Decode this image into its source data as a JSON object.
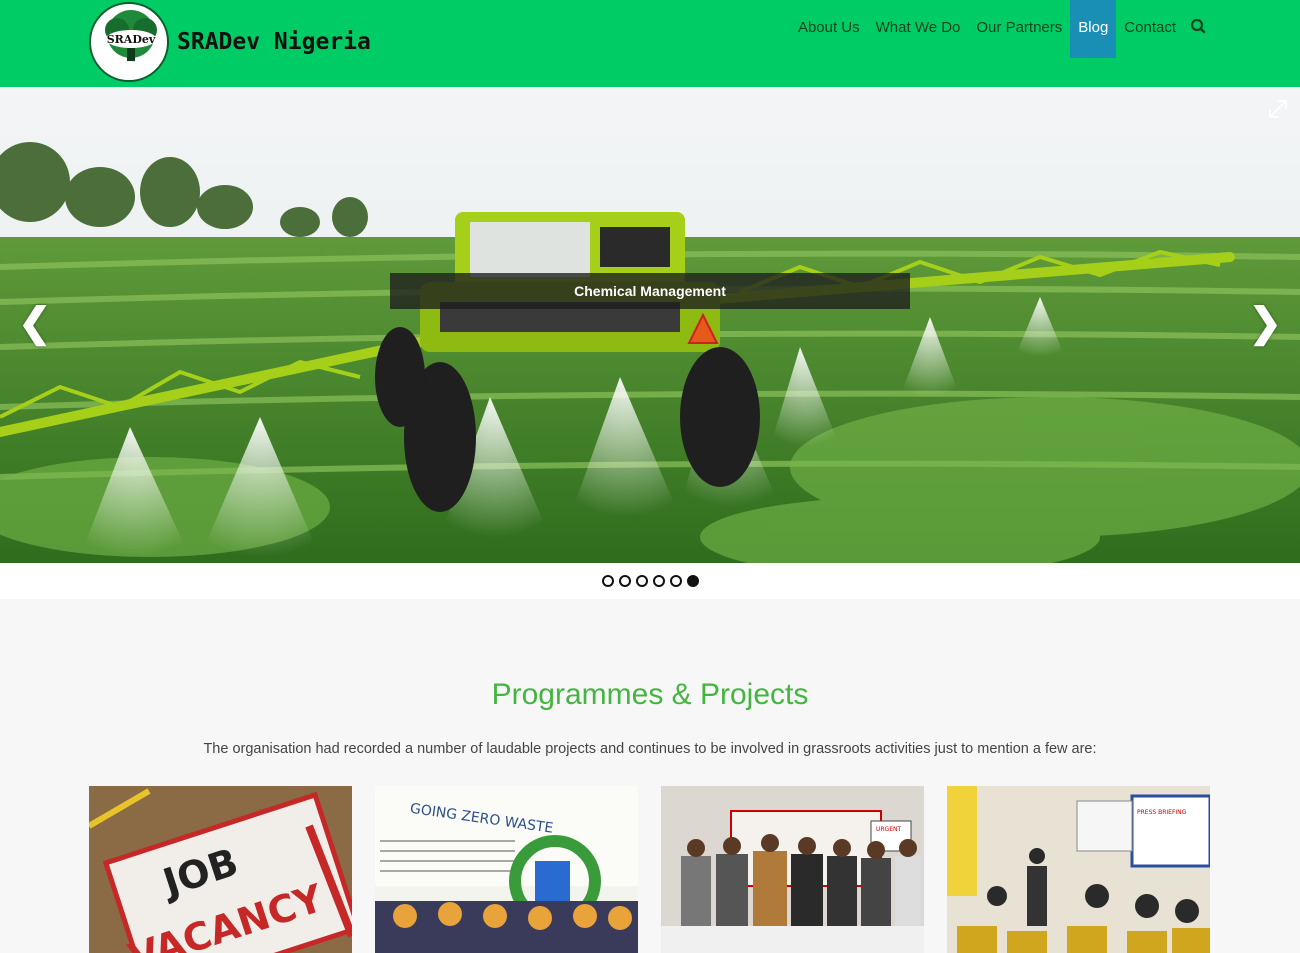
{
  "header": {
    "brand_name": "SRADev Nigeria",
    "logo_badge": "SRADev",
    "nav": [
      {
        "label": "About Us",
        "active": false
      },
      {
        "label": "What We Do",
        "active": false
      },
      {
        "label": "Our Partners",
        "active": false
      },
      {
        "label": "Blog",
        "active": true
      },
      {
        "label": "Contact",
        "active": false
      }
    ],
    "search_icon": "search-icon"
  },
  "slider": {
    "caption": "Chemical Management",
    "prev_glyph": "❮",
    "next_glyph": "❯",
    "slide_count": 6,
    "active_slide": 6
  },
  "section": {
    "title": "Programmes & Projects",
    "subtitle": "The organisation had recorded a number of laudable projects and continues to be involved in grassroots activities just to mention a few are:"
  },
  "cards": [
    {
      "line1": "JOB",
      "line2": "VACANCY"
    },
    {
      "line1": "GOING ZERO WASTE"
    },
    {
      "line1": "URGENT"
    },
    {
      "line1": "PRESS BRIEFING"
    }
  ],
  "colors": {
    "header_green": "#00cc66",
    "active_nav": "#1a8fb5",
    "title_green": "#44b540"
  }
}
